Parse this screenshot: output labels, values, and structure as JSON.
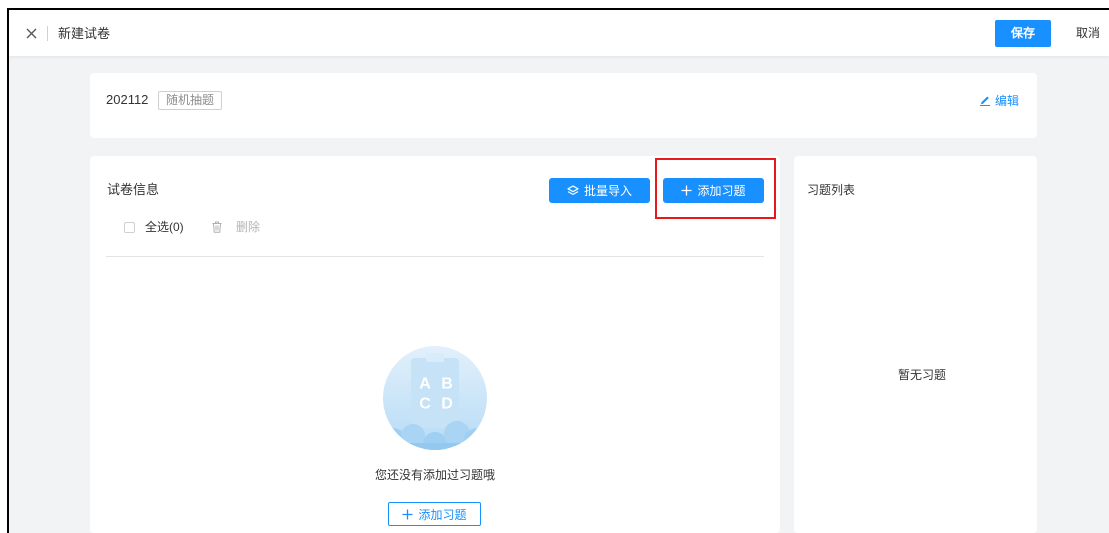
{
  "header": {
    "close_icon": "close-icon",
    "title": "新建试卷",
    "save_label": "保存",
    "cancel_label": "取消"
  },
  "summary": {
    "name": "202112",
    "tag": "随机抽题",
    "edit_icon": "pencil-icon",
    "edit_label": "编辑"
  },
  "paper_info": {
    "title": "试卷信息",
    "batch_import_icon": "layers-icon",
    "batch_import_label": "批量导入",
    "add_question_icon": "plus-icon",
    "add_question_label": "添加习题",
    "select_all_label": "全选(0)",
    "delete_icon": "trash-icon",
    "delete_label": "删除",
    "empty": {
      "illustration_letters": [
        "A",
        "B",
        "C",
        "D"
      ],
      "message": "您还没有添加过习题哦",
      "add_button_icon": "plus-icon",
      "add_button_label": "添加习题"
    }
  },
  "question_list": {
    "title": "习题列表",
    "empty_message": "暂无习题"
  },
  "colors": {
    "primary": "#1890ff",
    "highlight": "#e8191a",
    "background": "#f2f3f5"
  }
}
